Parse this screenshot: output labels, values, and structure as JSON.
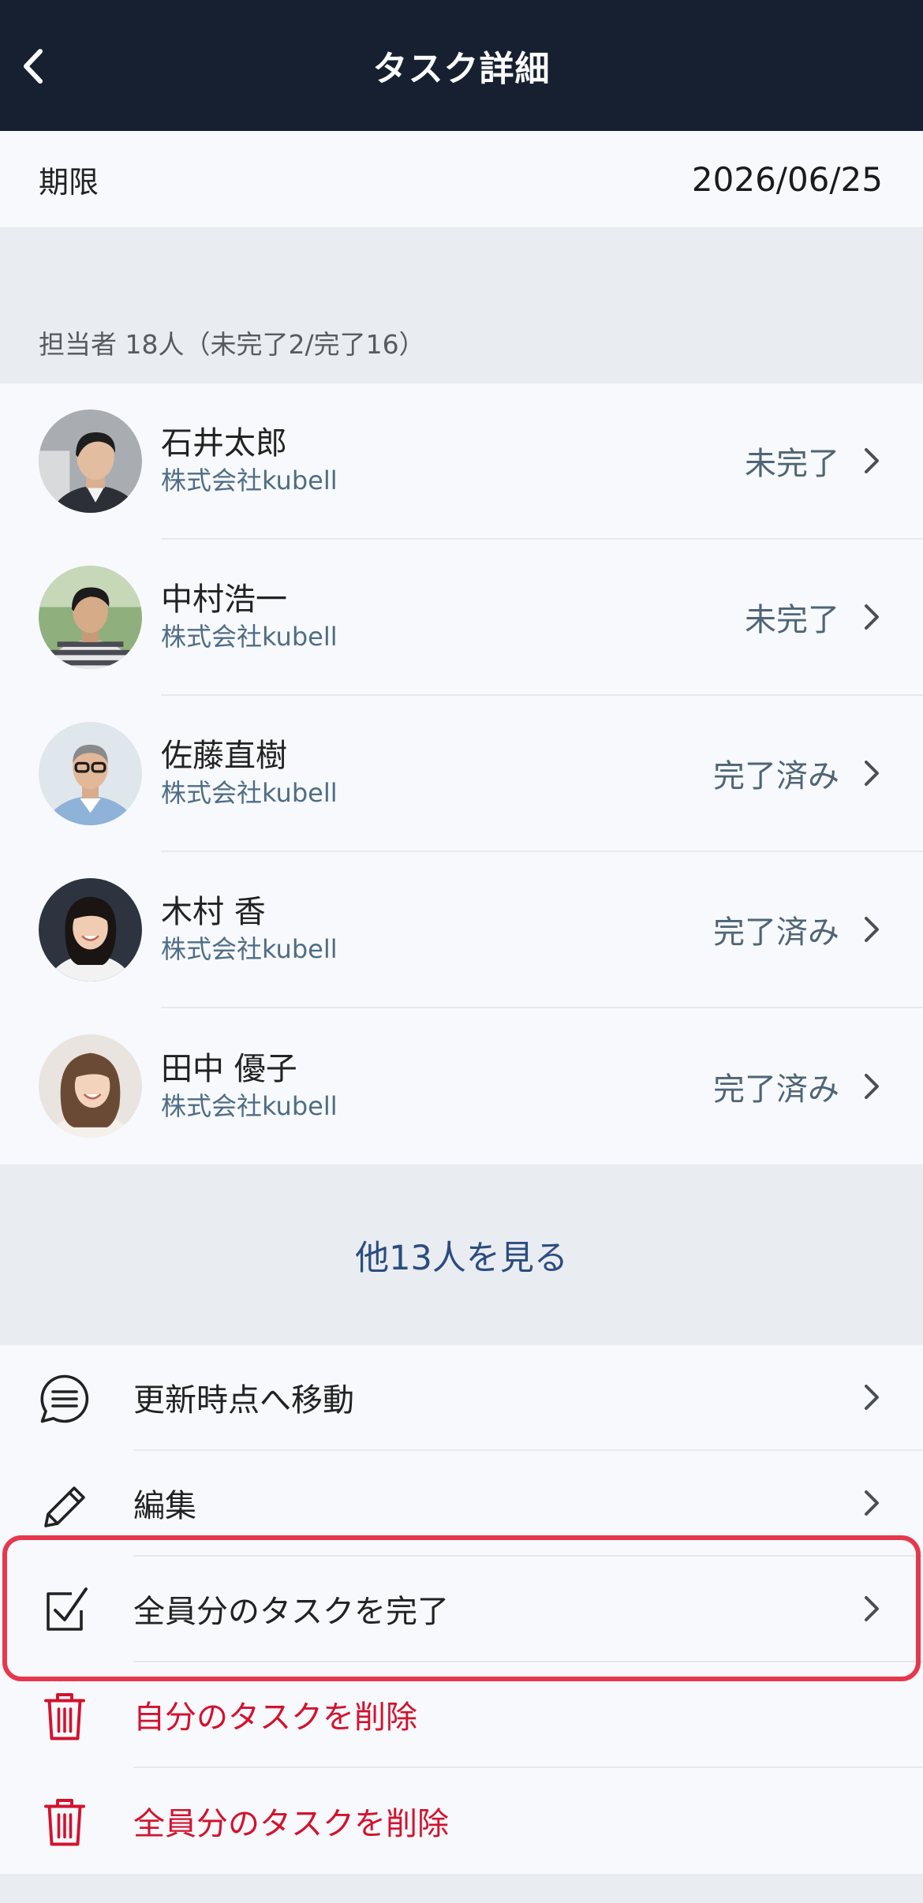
{
  "header": {
    "title": "タスク詳細",
    "back_icon": "chevron-left-icon"
  },
  "due": {
    "label": "期限",
    "value": "2026/06/25"
  },
  "assignees": {
    "section_title": "担当者 18人（未完了2/完了16）",
    "items": [
      {
        "name": "石井太郎",
        "company": "株式会社kubell",
        "status": "未完了"
      },
      {
        "name": "中村浩一",
        "company": "株式会社kubell",
        "status": "未完了"
      },
      {
        "name": "佐藤直樹",
        "company": "株式会社kubell",
        "status": "完了済み"
      },
      {
        "name": "木村 香",
        "company": "株式会社kubell",
        "status": "完了済み"
      },
      {
        "name": "田中 優子",
        "company": "株式会社kubell",
        "status": "完了済み"
      }
    ],
    "more_label": "他13人を見る"
  },
  "actions": [
    {
      "label": "更新時点へ移動",
      "icon": "chat-list-icon",
      "danger": false,
      "has_chevron": true
    },
    {
      "label": "編集",
      "icon": "pencil-icon",
      "danger": false,
      "has_chevron": true
    },
    {
      "label": "全員分のタスクを完了",
      "icon": "checkbox-checked-icon",
      "danger": false,
      "has_chevron": true,
      "highlighted": true
    },
    {
      "label": "自分のタスクを削除",
      "icon": "trash-icon",
      "danger": true,
      "has_chevron": false
    },
    {
      "label": "全員分のタスクを削除",
      "icon": "trash-icon",
      "danger": true,
      "has_chevron": false
    }
  ],
  "colors": {
    "header_bg": "#162030",
    "list_bg": "#f7f9fc",
    "section_bg": "#e9ecf0",
    "link": "#2b4c80",
    "danger": "#d3122e",
    "highlight": "#e5384d"
  }
}
